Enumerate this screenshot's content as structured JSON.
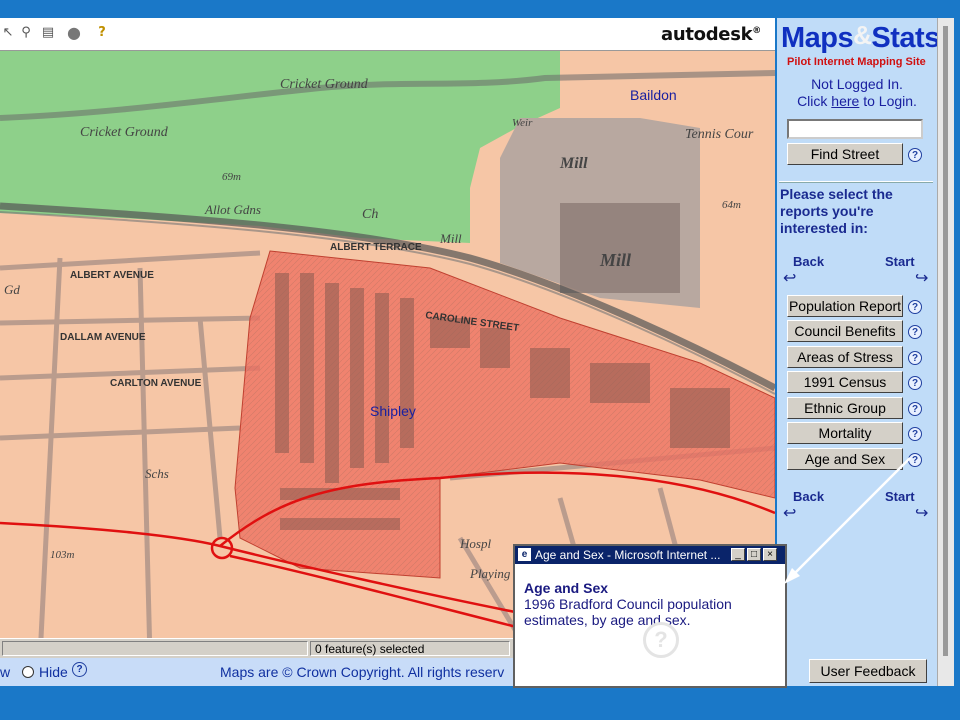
{
  "toolbar": {
    "brand": "autodesk",
    "brand_mark": "®"
  },
  "map": {
    "labels": {
      "baildon": "Baildon",
      "shipley": "Shipley",
      "cricket_ground_1": "Cricket Ground",
      "cricket_ground_2": "Cricket Ground",
      "allot_gdns": "Allot Gdns",
      "mill_1": "Mill",
      "mill_2": "Mill",
      "mill_3": "Mill",
      "tennis_court": "Tennis Cour",
      "weir": "Weir",
      "albert_avenue": "ALBERT AVENUE",
      "albert_terrace": "ALBERT TERRACE",
      "dallam_avenue": "DALLAM AVENUE",
      "carlton_avenue": "CARLTON AVENUE",
      "caroline_street": "CAROLINE STREET",
      "schs": "Schs",
      "hospl": "Hospl",
      "playing_field": "Playing Field",
      "ch": "Ch",
      "gd": "Gd",
      "height_69m": "69m",
      "height_64m": "64m",
      "height_103m": "103m"
    },
    "colors": {
      "urban": "#f6c6a6",
      "park": "#8ed08a",
      "mill_area": "#b8a8a0",
      "selected_region": "#ee7060",
      "roads": "#e01010"
    }
  },
  "statusbar": {
    "selected": "0 feature(s) selected"
  },
  "bottombar": {
    "show_label": "w",
    "hide_label": "Hide",
    "copyright": "Maps are © Crown Copyright. All rights reserv"
  },
  "panel": {
    "logo_maps": "Maps",
    "logo_amp": "&",
    "logo_stats": "Stats",
    "subtitle": "Pilot Internet Mapping Site",
    "login_status": "Not Logged In.",
    "login_prefix": "Click ",
    "login_link": "here",
    "login_suffix": " to Login.",
    "search_value": "",
    "find_street": "Find Street",
    "prompt": "Please select the reports you're interested in:",
    "back": "Back",
    "start": "Start",
    "reports": [
      "Population Report",
      "Council Benefits",
      "Areas of Stress",
      "1991 Census",
      "Ethnic Group",
      "Mortality",
      "Age and Sex"
    ],
    "help_glyph": "?",
    "feedback": "User Feedback"
  },
  "popup": {
    "title": "Age and Sex - Microsoft Internet ...",
    "heading": "Age and Sex",
    "body": "1996 Bradford Council population estimates, by age and sex."
  }
}
